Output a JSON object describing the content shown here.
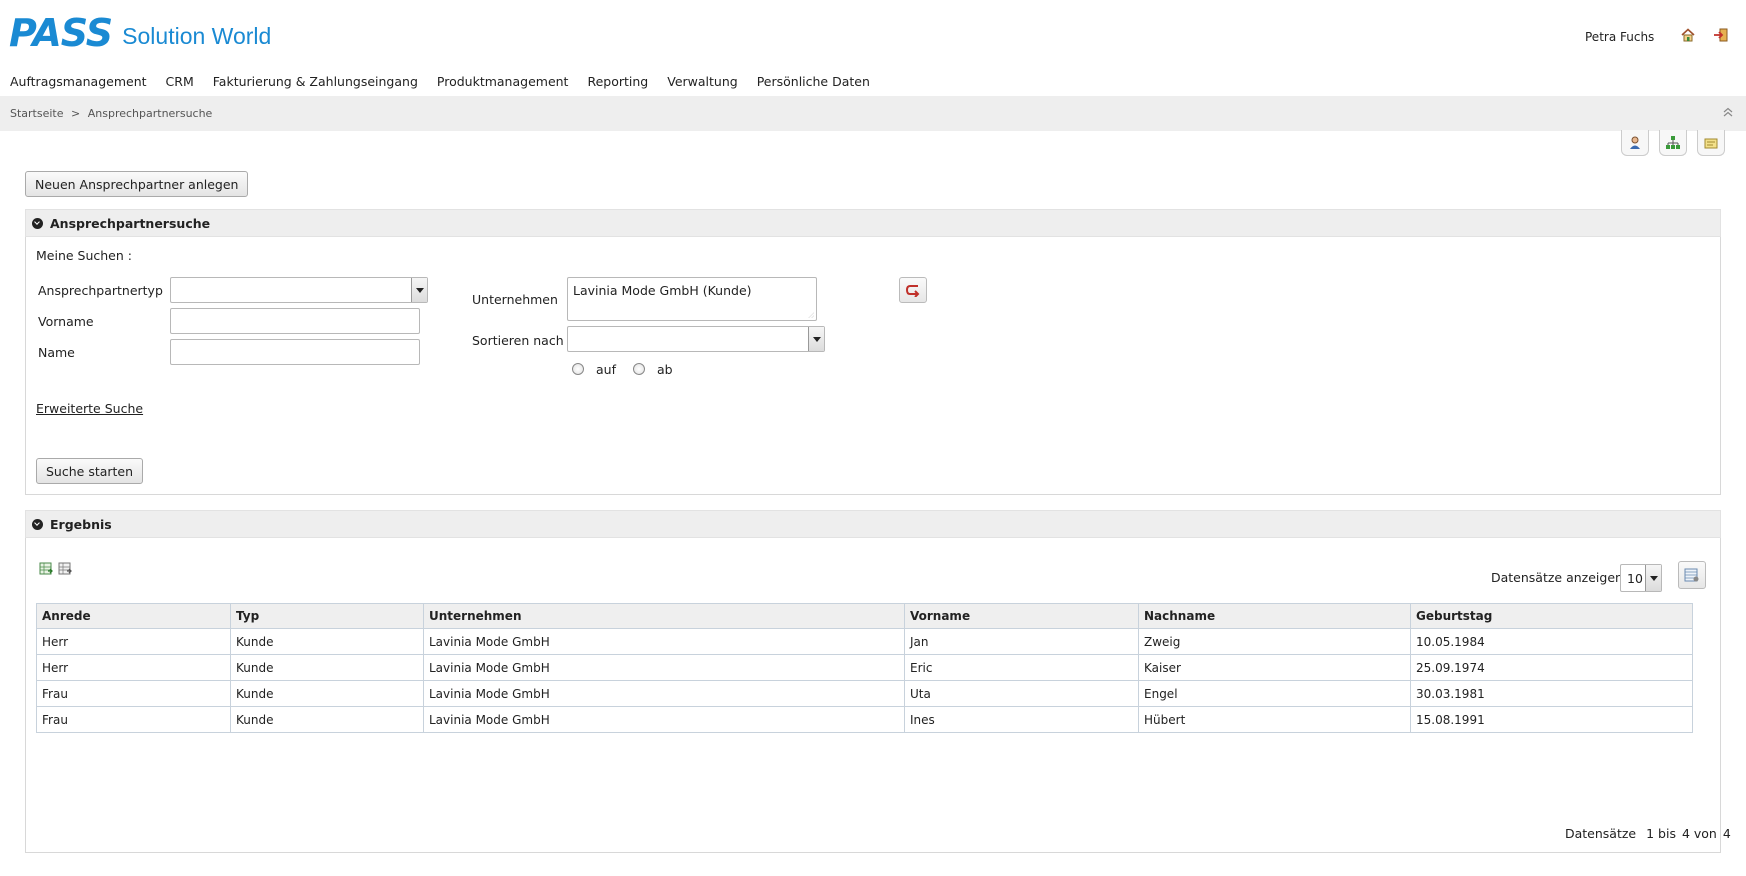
{
  "header": {
    "logo_pass": "PASS",
    "logo_solution": "Solution World",
    "user_name": "Petra Fuchs",
    "home_icon": "home-icon",
    "logout_icon": "logout-icon"
  },
  "nav": {
    "items": [
      {
        "label": "Auftragsmanagement"
      },
      {
        "label": "CRM"
      },
      {
        "label": "Fakturierung & Zahlungseingang"
      },
      {
        "label": "Produktmanagement"
      },
      {
        "label": "Reporting"
      },
      {
        "label": "Verwaltung"
      },
      {
        "label": "Persönliche Daten"
      }
    ]
  },
  "breadcrumb": {
    "home": "Startseite",
    "separator": ">",
    "current": "Ansprechpartnersuche"
  },
  "actions": {
    "new_contact_label": "Neuen Ansprechpartner anlegen"
  },
  "search": {
    "title": "Ansprechpartnersuche",
    "my_searches_label": "Meine Suchen :",
    "type_label": "Ansprechpartnertyp",
    "type_value": "",
    "firstname_label": "Vorname",
    "firstname_value": "",
    "name_label": "Name",
    "name_value": "",
    "company_label": "Unternehmen",
    "company_value": "Lavinia Mode GmbH (Kunde)",
    "sort_label": "Sortieren nach",
    "sort_value": "",
    "asc_label": "auf",
    "desc_label": "ab",
    "advanced_link": "Erweiterte Suche",
    "start_button": "Suche starten"
  },
  "results": {
    "title": "Ergebnis",
    "page_size_label": "Datensätze anzeigen:",
    "page_size_value": "10",
    "columns": [
      "Anrede",
      "Typ",
      "Unternehmen",
      "Vorname",
      "Nachname",
      "Geburtstag"
    ],
    "rows": [
      [
        "Herr",
        "Kunde",
        "Lavinia Mode GmbH",
        "Jan",
        "Zweig",
        "10.05.1984"
      ],
      [
        "Herr",
        "Kunde",
        "Lavinia Mode GmbH",
        "Eric",
        "Kaiser",
        "25.09.1974"
      ],
      [
        "Frau",
        "Kunde",
        "Lavinia Mode GmbH",
        "Uta",
        "Engel",
        "30.03.1981"
      ],
      [
        "Frau",
        "Kunde",
        "Lavinia Mode GmbH",
        "Ines",
        "Hübert",
        "15.08.1991"
      ]
    ],
    "footer": {
      "label": "Datensätze",
      "from": "1",
      "to_label": "bis",
      "to": "4",
      "of_label": "von",
      "total": "4"
    }
  },
  "colors": {
    "brand": "#1a8ad3",
    "panel_header": "#eeeeee",
    "table_border": "#c8d2dc"
  }
}
